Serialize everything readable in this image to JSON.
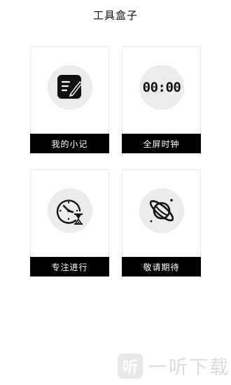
{
  "header": {
    "title": "工具盒子"
  },
  "cards": [
    {
      "label": "我的小记",
      "icon": "notepad-icon"
    },
    {
      "label": "全屏时钟",
      "icon": "digital-clock-icon",
      "icon_text": "00:00"
    },
    {
      "label": "专注进行",
      "icon": "clock-hourglass-icon"
    },
    {
      "label": "敬请期待",
      "icon": "planet-icon"
    }
  ],
  "watermark": {
    "logo_text": "听",
    "text": "一听下载"
  }
}
